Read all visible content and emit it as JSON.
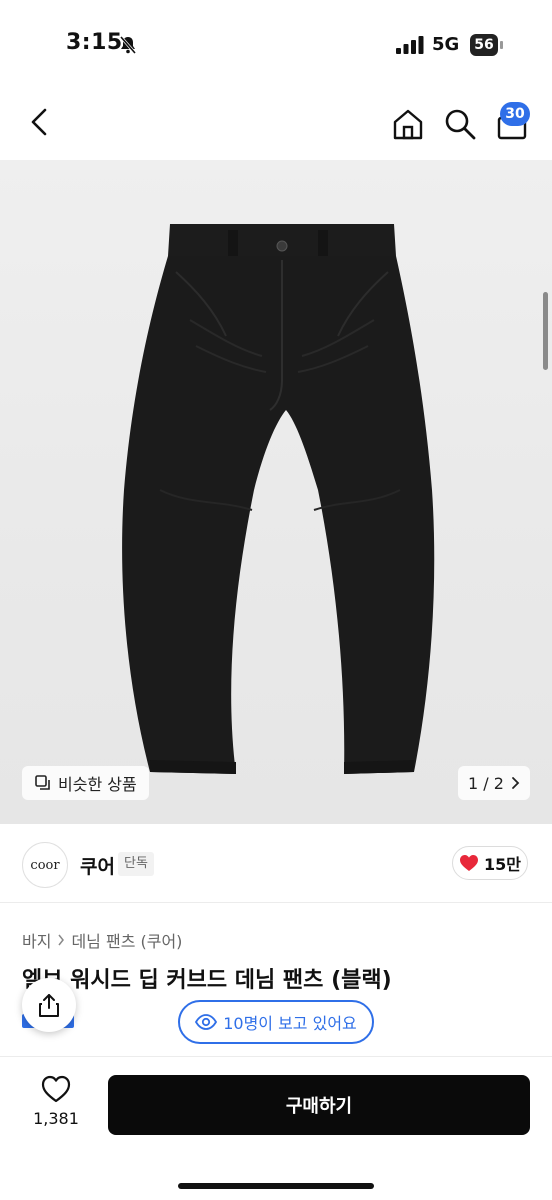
{
  "status_bar": {
    "time": "3:15",
    "network": "5G",
    "battery": "56"
  },
  "header": {
    "icons": [
      "back-icon",
      "home-icon",
      "search-icon",
      "cart-icon"
    ],
    "cart_count": "30"
  },
  "gallery": {
    "similar_label": "비슷한 상품",
    "page_indicator": "1 / 2"
  },
  "store": {
    "logo_text": "coor",
    "name": "쿠어",
    "badge": "단독",
    "likes": "15만"
  },
  "product": {
    "breadcrumb": [
      "바지",
      "데님 팬츠 (쿠어)"
    ],
    "title": "엘보 워시드 딥 커브드 데님 팬츠 (블랙)"
  },
  "viewers_text": "10명이 보고 있어요",
  "bottom_bar": {
    "wish_count": "1,381",
    "buy_label": "구매하기"
  },
  "colors": {
    "accent_blue": "#2f6fe8",
    "heart_red": "#e8283a",
    "buy_button_bg": "#0a0a0a"
  }
}
